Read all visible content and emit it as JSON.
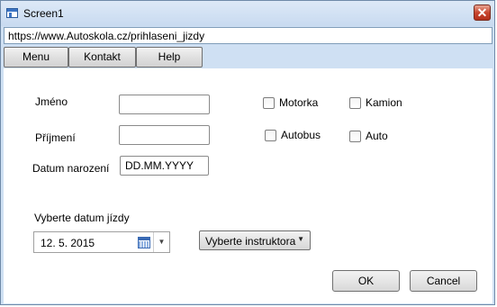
{
  "window": {
    "title": "Screen1"
  },
  "url": "https://www.Autoskola.cz/prihlaseni_jizdy",
  "menu": [
    "Menu",
    "Kontakt",
    "Help"
  ],
  "form": {
    "jmeno_label": "Jméno",
    "prijmeni_label": "Příjmení",
    "datum_narozeni_label": "Datum narození",
    "datum_narozeni_value": "DD.MM.YYYY",
    "checkboxes": [
      "Motorka",
      "Kamion",
      "Autobus",
      "Auto"
    ],
    "vyberte_datum_label": "Vyberte datum jízdy",
    "date_value": "12. 5. 2015",
    "instructor_value": "Vyberte instruktora"
  },
  "buttons": {
    "ok": "OK",
    "cancel": "Cancel"
  }
}
